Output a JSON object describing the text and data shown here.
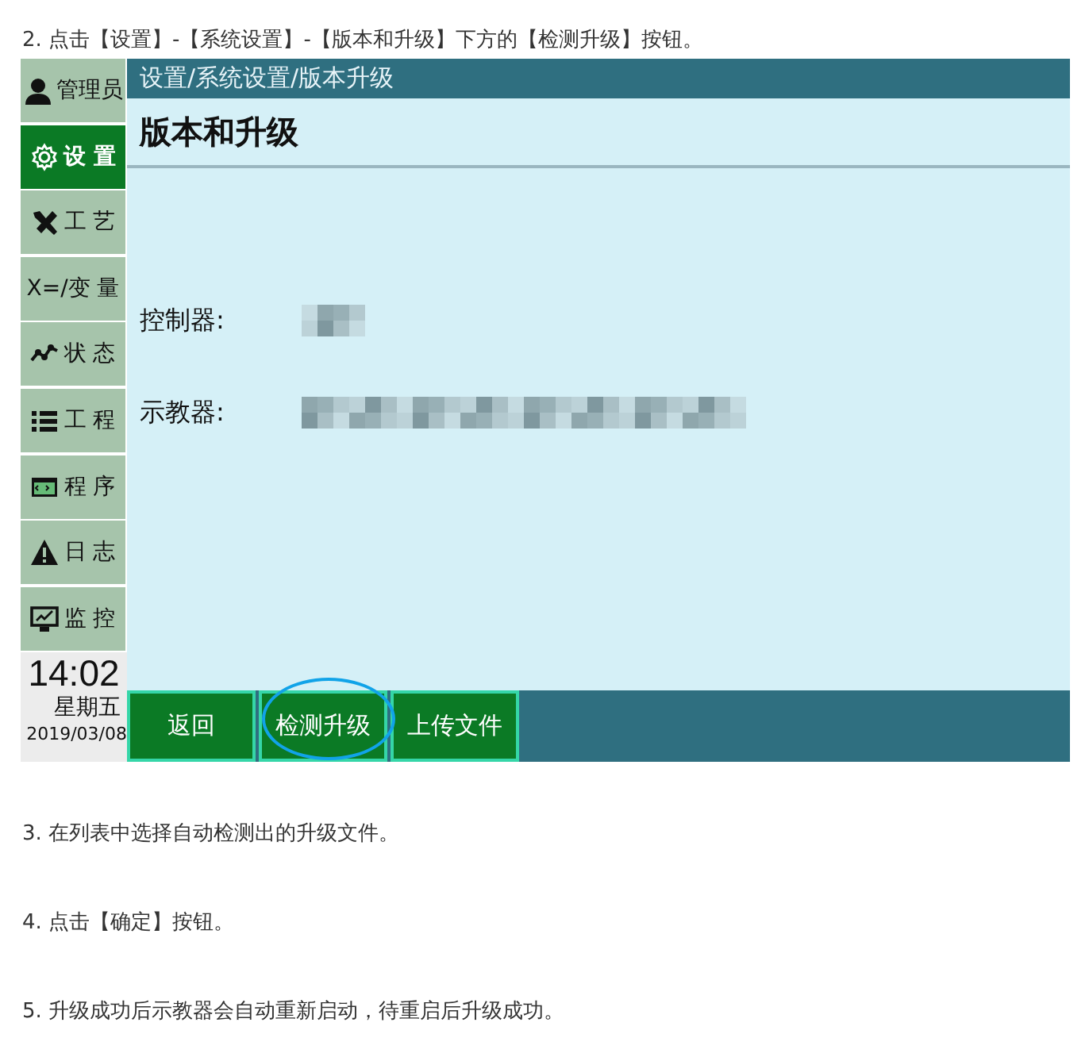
{
  "steps_before": [
    {
      "text": "2. 点击【设置】-【系统设置】-【版本和升级】下方的【检测升级】按钮。"
    }
  ],
  "screenshot": {
    "sidebar": {
      "items": [
        {
          "kind": "user",
          "label": "管理员",
          "selected": false
        },
        {
          "kind": "gear",
          "label": "设 置",
          "selected": true
        },
        {
          "kind": "tools",
          "label": "工 艺",
          "selected": false
        },
        {
          "kind": "variable",
          "label": "X=/变 量",
          "selected": false
        },
        {
          "kind": "status",
          "label": "状 态",
          "selected": false
        },
        {
          "kind": "list",
          "label": "工 程",
          "selected": false
        },
        {
          "kind": "program",
          "label": "程 序",
          "selected": false
        },
        {
          "kind": "warning",
          "label": "日 志",
          "selected": false
        },
        {
          "kind": "monitor",
          "label": "监 控",
          "selected": false
        }
      ],
      "clock": {
        "time": "14:02",
        "weekday": "星期五",
        "date": "2019/03/08"
      }
    },
    "breadcrumb": "设置/系统设置/版本升级",
    "title": "版本和升级",
    "info_rows": [
      {
        "kind": "short",
        "label": "控制器:",
        "redacted": true
      },
      {
        "kind": "long",
        "label": "示教器:",
        "redacted": true
      }
    ],
    "buttons": [
      {
        "label": "返回",
        "highlighted": false
      },
      {
        "label": "检测升级",
        "highlighted": true
      },
      {
        "label": "上传文件",
        "highlighted": false
      }
    ]
  },
  "steps_after": [
    {
      "text": "3. 在列表中选择自动检测出的升级文件。"
    },
    {
      "text": "4. 点击【确定】按钮。"
    },
    {
      "text": "5. 升级成功后示教器会自动重新启动，待重启后升级成功。"
    }
  ]
}
